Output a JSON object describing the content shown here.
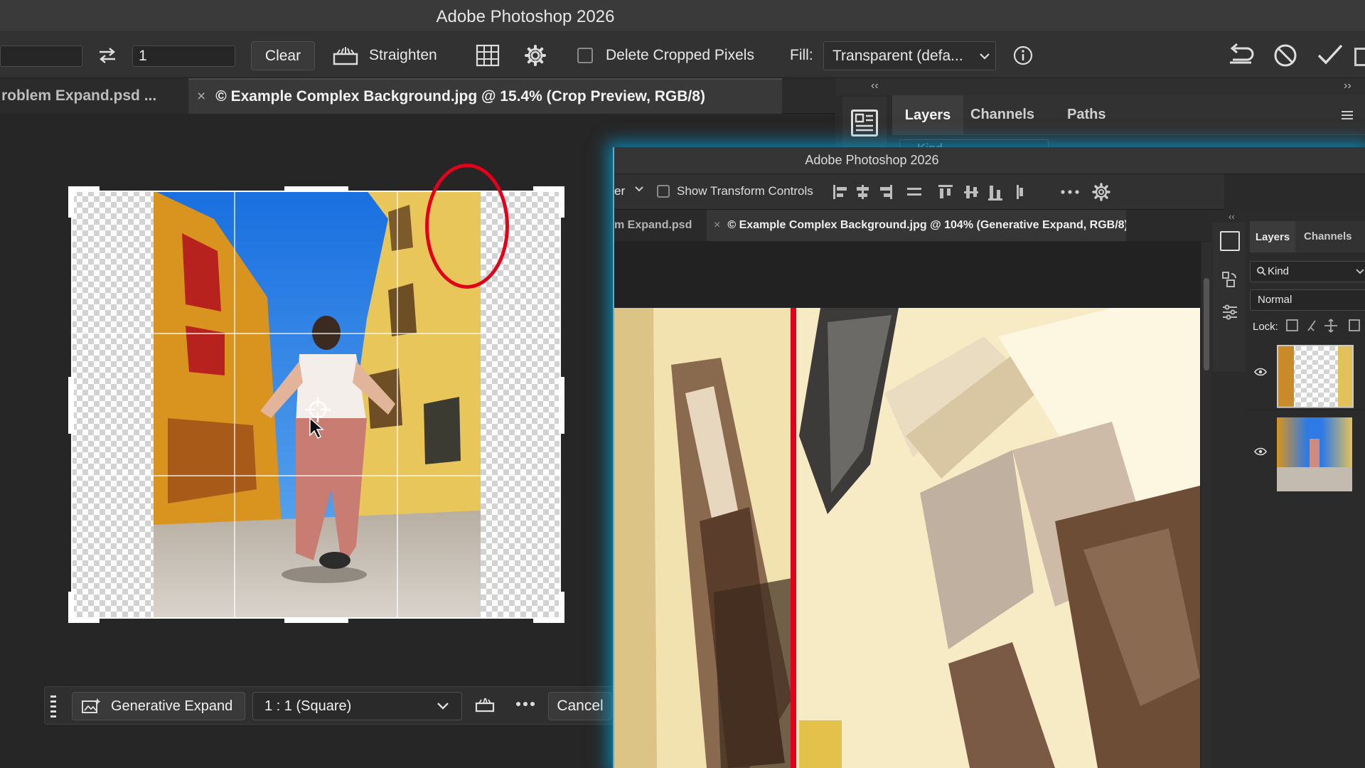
{
  "app_title": "Adobe Photoshop 2026",
  "options_bar": {
    "ratio_value": "1",
    "clear_label": "Clear",
    "straighten_label": "Straighten",
    "delete_cropped_label": "Delete Cropped Pixels",
    "fill_label": "Fill:",
    "fill_value": "Transparent (defa..."
  },
  "doc_tabs": [
    {
      "label": "roblem Expand.psd ..."
    },
    {
      "label": "© Example Complex Background.jpg @ 15.4% (Crop Preview, RGB/8)"
    }
  ],
  "right_panel": {
    "tabs": [
      "Layers",
      "Channels",
      "Paths"
    ],
    "search_placeholder": "Kind"
  },
  "context_bar": {
    "generative_expand_label": "Generative Expand",
    "ratio_preset": "1 : 1 (Square)",
    "cancel_label": "Cancel"
  },
  "inset_window": {
    "title": "Adobe Photoshop 2026",
    "options_partial": "er",
    "show_transform_label": "Show Transform Controls",
    "doc_tabs": [
      {
        "label": "m Expand.psd"
      },
      {
        "label": "© Example Complex Background.jpg @ 104% (Generative Expand, RGB/8) *"
      }
    ],
    "panel_tabs": [
      "Layers",
      "Channels"
    ],
    "kind_label": "Kind",
    "blend_mode": "Normal",
    "lock_label": "Lock:"
  },
  "colors": {
    "accent_glow": "#00aae6",
    "annotation_red": "#e3001b",
    "ui_dark": "#262626"
  }
}
